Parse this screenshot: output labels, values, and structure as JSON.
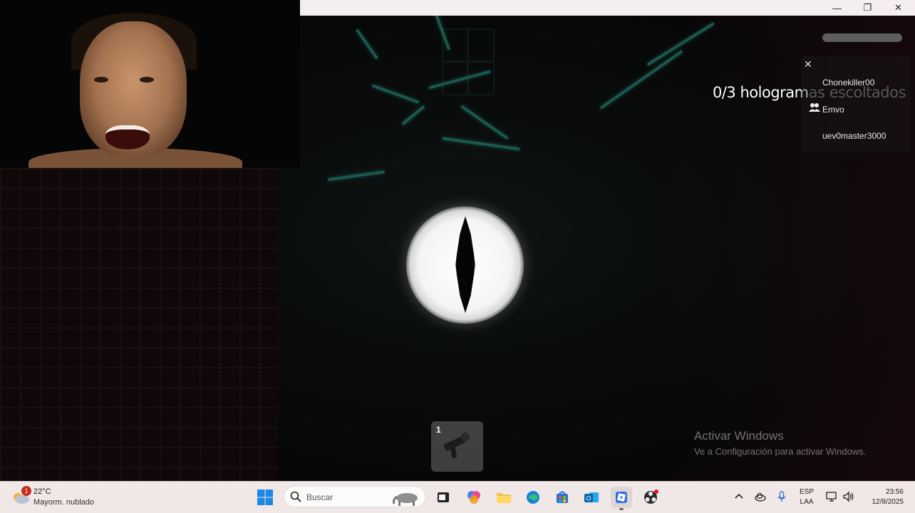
{
  "game": {
    "objective": {
      "counter": "0/3 hologram",
      "rest": "as escoltados"
    },
    "players": {
      "close_icon": "close-icon",
      "list": [
        "Chonekiller00",
        "Emvo",
        "uev0master3000"
      ]
    },
    "hotbar": {
      "slot_number": "1",
      "item_icon": "flashlight-gun-icon"
    }
  },
  "watermark": {
    "title": "Activar Windows",
    "subtitle": "Ve a Configuración para activar Windows."
  },
  "window_controls": {
    "minimize": "—",
    "maximize": "❐",
    "close": "✕"
  },
  "taskbar": {
    "weather": {
      "badge": "1",
      "temp": "22°C",
      "desc": "Mayorm. nublado"
    },
    "search": {
      "placeholder": "Buscar"
    },
    "apps": [
      "file-explorer-dark",
      "copilot",
      "file-explorer",
      "edge",
      "store",
      "outlook",
      "roblox",
      "obs"
    ],
    "language": {
      "line1": "ESP",
      "line2": "LAA"
    },
    "clock": {
      "time": "23:56",
      "date": "12/8/2025"
    }
  },
  "colors": {
    "creature": "#1f6b5f",
    "taskbar": "#f0e7e7",
    "accent_red": "#c42b1c"
  }
}
